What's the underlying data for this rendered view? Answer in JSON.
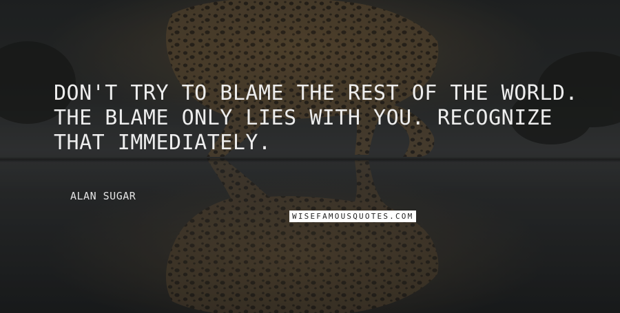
{
  "quote": {
    "text": "Don't try to blame the rest of the world. The blame only lies with you. Recognize that immediately.",
    "author": "Alan Sugar"
  },
  "watermark": {
    "text": "wisefamousquotes.com"
  },
  "background": {
    "subject": "leopard-drinking-with-reflection",
    "colors": {
      "sky": "#2c2d2d",
      "water": "#3a3b3c",
      "leopard_fur": "#7a5f3c",
      "text": "#ededed"
    }
  }
}
